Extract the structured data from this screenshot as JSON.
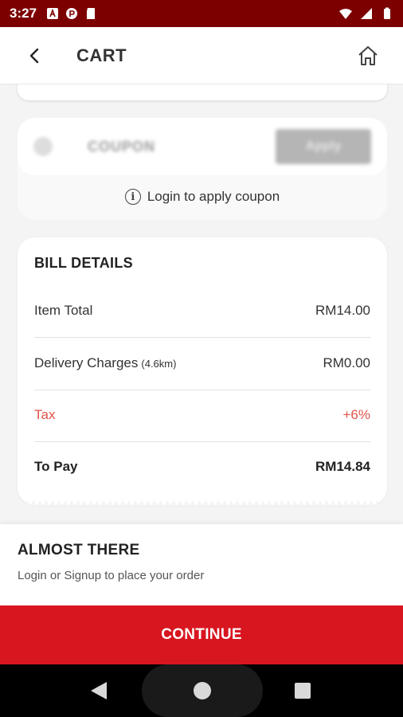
{
  "status_bar": {
    "time": "3:27",
    "left_icons": [
      "font-icon",
      "at-icon",
      "sd-card-icon"
    ],
    "right_icons": [
      "wifi-icon",
      "signal-icon",
      "battery-icon"
    ]
  },
  "header": {
    "title": "CART",
    "back_icon": "back-chevron-icon",
    "home_icon": "home-icon"
  },
  "coupon": {
    "label": "COUPON",
    "apply_label": "Apply",
    "login_hint": "Login to apply coupon"
  },
  "bill": {
    "title": "BILL DETAILS",
    "rows": [
      {
        "label": "Item Total",
        "sub": "",
        "value": "RM14.00"
      },
      {
        "label": "Delivery Charges",
        "sub": "(4.6km)",
        "value": "RM0.00"
      },
      {
        "label": "Tax",
        "sub": "",
        "value": "+6%"
      },
      {
        "label": "To Pay",
        "sub": "",
        "value": "RM14.84"
      }
    ]
  },
  "sheet": {
    "title": "ALMOST THERE",
    "subtitle": "Login or Signup to place your order"
  },
  "continue_label": "CONTINUE",
  "colors": {
    "status_bar": "#7d0000",
    "primary": "#d81620",
    "tax": "#e2544a"
  }
}
